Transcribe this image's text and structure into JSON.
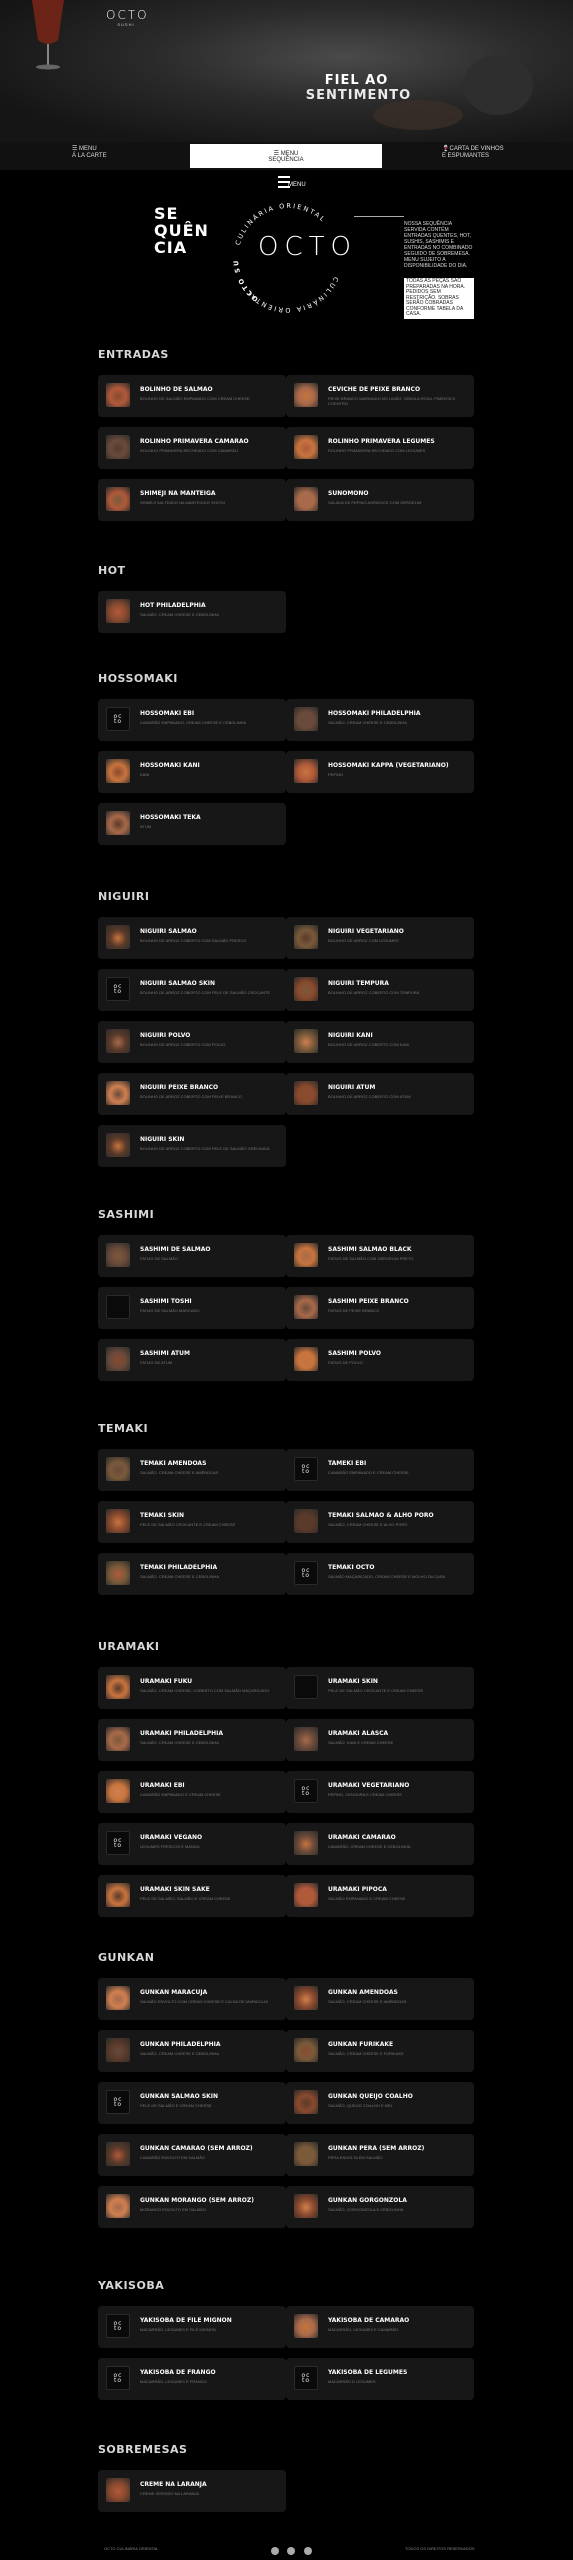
{
  "header": {
    "logo": "OCTO",
    "logo_sub": "SUSHI",
    "hero_line1": "FIEL AO",
    "hero_line2": "SENTIMENTO"
  },
  "nav": {
    "left": [
      "MENU",
      "Á LA CARTE"
    ],
    "center": [
      "MENU",
      "SEQUÊNCIA"
    ],
    "right": [
      "CARTA DE VINHOS",
      "E ESPUMANTES"
    ],
    "menu_button": "MENU"
  },
  "sequence": {
    "title": [
      "SE",
      "QUÊN",
      "CIA"
    ],
    "badge_word": "OCTO",
    "badge_ring_top": "CULINÁRIA ORIENTAL",
    "badge_ring_left": "OCTO SUSHI",
    "description": "NOSSA SEQUÊNCIA SERVIDA CONTÉM ENTRADAS QUENTES, HOT, SUSHIS, SASHIMIS E ENTRADAS NO COMBINADO SEGUIDO DE SOBREMESA. MENU SUJEITO A DISPONIBILIDADE DO DIA.",
    "note": "TODAS AS PEÇAS SÃO PREPARADAS NA HORA. PEDIDOS SEM RESTRIÇÃO. SOBRAS SERÃO COBRADAS CONFORME TABELA DA CASA."
  },
  "sections": [
    {
      "title": "ENTRADAS",
      "items": [
        {
          "name": "BOLINHO DE SALMÃO",
          "desc": "BOLINHO DE SALMÃO EMPANADO COM CREAM CHEESE",
          "thumb": "photo"
        },
        {
          "name": "CEVICHE DE PEIXE BRANCO",
          "desc": "PEIXE BRANCO MARINADO NO LIMÃO, CEBOLA ROXA, PIMENTA E COENTRO",
          "thumb": "photo"
        },
        {
          "name": "ROLINHO PRIMAVERA CAMARÃO",
          "desc": "ROLINHO PRIMAVERA RECHEADO COM CAMARÃO",
          "thumb": "photo"
        },
        {
          "name": "ROLINHO PRIMAVERA LEGUMES",
          "desc": "ROLINHO PRIMAVERA RECHEADO COM LEGUMES",
          "thumb": "photo"
        },
        {
          "name": "SHIMEJI NA MANTEIGA",
          "desc": "SHIMEJI SALTEADO NA MANTEIGA E SHOYU",
          "thumb": "photo"
        },
        {
          "name": "SUNOMONO",
          "desc": "SALADA DE PEPINO AGRIDOCE COM GERGELIM",
          "thumb": "photo"
        }
      ]
    },
    {
      "title": "HOT",
      "items": [
        {
          "name": "HOT PHILADELPHIA",
          "desc": "SALMÃO, CREAM CHEESE E CEBOLINHA",
          "thumb": "photo"
        }
      ]
    },
    {
      "title": "HOSSOMAKI",
      "items": [
        {
          "name": "HOSSOMAKI EBI",
          "desc": "CAMARÃO EMPANADO, CREAM CHEESE E CEBOLINHA",
          "thumb": "logo"
        },
        {
          "name": "HOSSOMAKI PHILADELPHIA",
          "desc": "SALMÃO, CREAM CHEESE E CEBOLINHA",
          "thumb": "photo"
        },
        {
          "name": "HOSSOMAKI KANI",
          "desc": "KANI",
          "thumb": "photo"
        },
        {
          "name": "HOSSOMAKI KAPPA (VEGETARIANO)",
          "desc": "PEPINO",
          "thumb": "photo"
        },
        {
          "name": "HOSSOMAKI TEKA",
          "desc": "ATUM",
          "thumb": "photo"
        }
      ]
    },
    {
      "title": "NIGUIRI",
      "items": [
        {
          "name": "NIGUIRI SALMÃO",
          "desc": "BOLINHO DE ARROZ COBERTO COM SALMÃO FRESCO",
          "thumb": "photo"
        },
        {
          "name": "NIGUIRI VEGETARIANO",
          "desc": "BOLINHO DE ARROZ COM LEGUMES",
          "thumb": "photo"
        },
        {
          "name": "NIGUIRI SALMÃO SKIN",
          "desc": "BOLINHO DE ARROZ COBERTO COM PELE DE SALMÃO CROCANTE",
          "thumb": "logo"
        },
        {
          "name": "NIGUIRI TEMPURA",
          "desc": "BOLINHO DE ARROZ COBERTO COM TEMPURÁ",
          "thumb": "photo"
        },
        {
          "name": "NIGUIRI POLVO",
          "desc": "BOLINHO DE ARROZ COBERTO COM POLVO",
          "thumb": "photo"
        },
        {
          "name": "NIGUIRI KANI",
          "desc": "BOLINHO DE ARROZ COBERTO COM KANI",
          "thumb": "photo"
        },
        {
          "name": "NIGUIRI PEIXE BRANCO",
          "desc": "BOLINHO DE ARROZ COBERTO COM PEIXE BRANCO",
          "thumb": "photo"
        },
        {
          "name": "NIGUIRI ATUM",
          "desc": "BOLINHO DE ARROZ COBERTO COM ATUM",
          "thumb": "photo"
        },
        {
          "name": "NIGUIRI SKIN",
          "desc": "BOLINHO DE ARROZ COBERTO COM PELE DE SALMÃO GRELHADA",
          "thumb": "photo"
        }
      ]
    },
    {
      "title": "SASHIMI",
      "items": [
        {
          "name": "SASHIMI DE SALMÃO",
          "desc": "FATIAS DE SALMÃO",
          "thumb": "photo"
        },
        {
          "name": "SASHIMI SALMÃO BLACK",
          "desc": "FATIAS DE SALMÃO COM GERGELIM PRETO",
          "thumb": "photo"
        },
        {
          "name": "SASHIMI TOSHI",
          "desc": "FATIAS DE SALMÃO MARCADO",
          "thumb": "dark"
        },
        {
          "name": "SASHIMI PEIXE BRANCO",
          "desc": "FATIAS DE PEIXE BRANCO",
          "thumb": "photo"
        },
        {
          "name": "SASHIMI ATUM",
          "desc": "FATIAS DE ATUM",
          "thumb": "photo"
        },
        {
          "name": "SASHIMI POLVO",
          "desc": "FATIAS DE POLVO",
          "thumb": "photo"
        }
      ]
    },
    {
      "title": "TEMAKI",
      "items": [
        {
          "name": "TEMAKI AMÊNDOAS",
          "desc": "SALMÃO, CREAM CHEESE E AMÊNDOAS",
          "thumb": "photo"
        },
        {
          "name": "TAMEKI EBI",
          "desc": "CAMARÃO EMPANADO E CREAM CHEESE",
          "thumb": "logo"
        },
        {
          "name": "TEMAKI SKIN",
          "desc": "PELE DE SALMÃO CROCANTE E CREAM CHEESE",
          "thumb": "photo"
        },
        {
          "name": "TEMAKI SALMÃO & ALHO PORÓ",
          "desc": "SALMÃO, CREAM CHEESE E ALHO PORÓ",
          "thumb": "photo"
        },
        {
          "name": "TEMAKI PHILADELPHIA",
          "desc": "SALMÃO, CREAM CHEESE E CEBOLINHA",
          "thumb": "photo"
        },
        {
          "name": "TEMAKI OCTO",
          "desc": "SALMÃO MAÇARICADO, CREAM CHEESE E MOLHO DA CASA",
          "thumb": "logo"
        }
      ]
    },
    {
      "title": "URAMAKI",
      "items": [
        {
          "name": "URAMAKI FUKU",
          "desc": "SALMÃO, CREAM CHEESE, COBERTO COM SALMÃO MAÇARICADO",
          "thumb": "photo"
        },
        {
          "name": "URAMAKI SKIN",
          "desc": "PELE DE SALMÃO CROCANTE E CREAM CHEESE",
          "thumb": "dark"
        },
        {
          "name": "URAMAKI PHILADELPHIA",
          "desc": "SALMÃO, CREAM CHEESE E CEBOLINHA",
          "thumb": "photo"
        },
        {
          "name": "URAMAKI ALASCA",
          "desc": "SALMÃO, KANI E CREAM CHEESE",
          "thumb": "photo"
        },
        {
          "name": "URAMAKI EBI",
          "desc": "CAMARÃO EMPANADO E CREAM CHEESE",
          "thumb": "photo"
        },
        {
          "name": "URAMAKI VEGETARIANO",
          "desc": "PEPINO, CENOURA E CREAM CHEESE",
          "thumb": "logo"
        },
        {
          "name": "URAMAKI VEGANO",
          "desc": "LEGUMES FRESCOS E MANGA",
          "thumb": "logo"
        },
        {
          "name": "URAMAKI CAMARÃO",
          "desc": "CAMARÃO, CREAM CHEESE E CEBOLINHA",
          "thumb": "photo"
        },
        {
          "name": "URAMAKI SKIN SAKE",
          "desc": "PELE DE SALMÃO, SALMÃO E CREAM CHEESE",
          "thumb": "photo"
        },
        {
          "name": "URAMAKI PIPOCA",
          "desc": "SALMÃO EMPANADO E CREAM CHEESE",
          "thumb": "photo"
        }
      ]
    },
    {
      "title": "GUNKAN",
      "items": [
        {
          "name": "GUNKAN MARACUJÁ",
          "desc": "SALMÃO ENVOLTO COM CREAM CHEESE E CALDA DE MARACUJÁ",
          "thumb": "photo"
        },
        {
          "name": "GUNKAN AMÊNDOAS",
          "desc": "SALMÃO, CREAM CHEESE E AMÊNDOAS",
          "thumb": "photo"
        },
        {
          "name": "GUNKAN PHILADELPHIA",
          "desc": "SALMÃO, CREAM CHEESE E CEBOLINHA",
          "thumb": "photo"
        },
        {
          "name": "GUNKAN FURIKAKE",
          "desc": "SALMÃO, CREAM CHEESE E FURIKAKE",
          "thumb": "photo"
        },
        {
          "name": "GUNKAN SALMÃO SKIN",
          "desc": "PELE DE SALMÃO E CREAM CHEESE",
          "thumb": "logo"
        },
        {
          "name": "GUNKAN QUEIJO COALHO",
          "desc": "SALMÃO, QUEIJO COALHO E MEL",
          "thumb": "photo"
        },
        {
          "name": "GUNKAN CAMARÃO (SEM ARROZ)",
          "desc": "CAMARÃO ENVOLTO EM SALMÃO",
          "thumb": "photo"
        },
        {
          "name": "GUNKAN PERA (SEM ARROZ)",
          "desc": "PERA ENVOLTA EM SALMÃO",
          "thumb": "photo"
        },
        {
          "name": "GUNKAN MORANGO (SEM ARROZ)",
          "desc": "MORANGO ENVOLTO EM SALMÃO",
          "thumb": "photo"
        },
        {
          "name": "GUNKAN GORGONZOLA",
          "desc": "SALMÃO, GORGONZOLA E CEBOLINHA",
          "thumb": "photo"
        }
      ]
    },
    {
      "title": "YAKISOBA",
      "items": [
        {
          "name": "YAKISOBA DE FILÉ MIGNON",
          "desc": "MACARRÃO, LEGUMES E FILÉ MIGNON",
          "thumb": "logo"
        },
        {
          "name": "YAKISOBA DE CAMARÃO",
          "desc": "MACARRÃO, LEGUMES E CAMARÃO",
          "thumb": "photo"
        },
        {
          "name": "YAKISOBA DE FRANGO",
          "desc": "MACARRÃO, LEGUMES E FRANGO",
          "thumb": "logo"
        },
        {
          "name": "YAKISOBA DE LEGUMES",
          "desc": "MACARRÃO E LEGUMES",
          "thumb": "logo"
        }
      ]
    },
    {
      "title": "SOBREMESAS",
      "items": [
        {
          "name": "CREME NA LARANJA",
          "desc": "CREME SERVIDO NA LARANJA",
          "thumb": "photo"
        }
      ]
    }
  ],
  "footer": {
    "left": "OCTO CULINÁRIA ORIENTAL",
    "right": "TODOS OS DIREITOS RESERVADOS"
  },
  "colors": {
    "background": "#000000",
    "card": "#171717",
    "accent_nav": "#ffffff"
  }
}
